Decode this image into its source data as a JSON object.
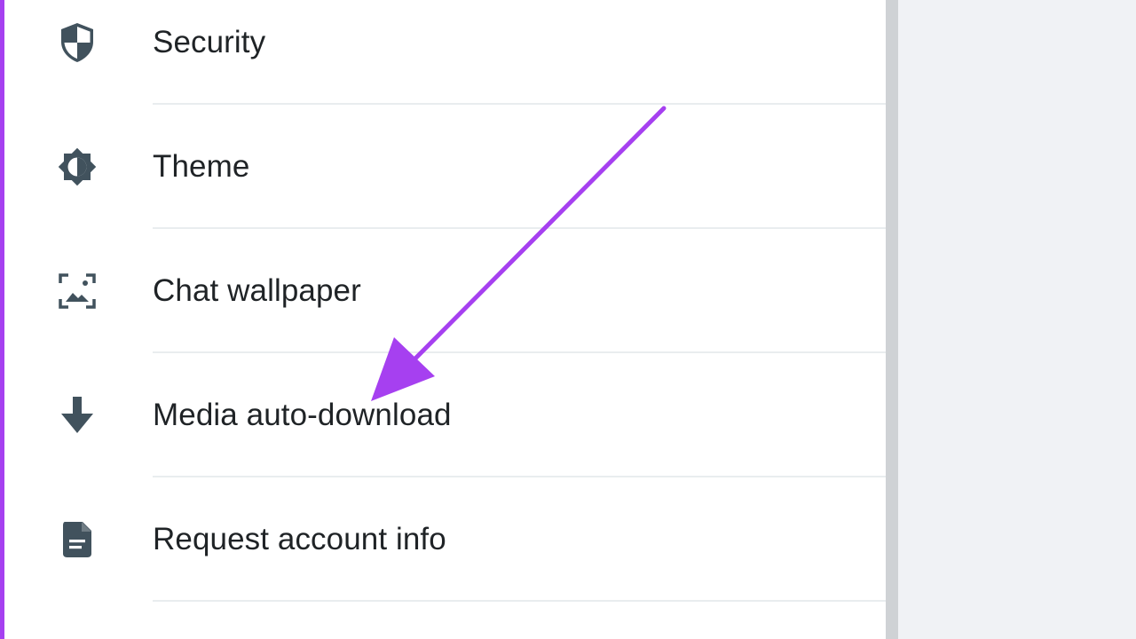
{
  "settings": {
    "items": [
      {
        "label": "Security",
        "icon": "shield-icon"
      },
      {
        "label": "Theme",
        "icon": "theme-icon"
      },
      {
        "label": "Chat wallpaper",
        "icon": "wallpaper-icon"
      },
      {
        "label": "Media auto-download",
        "icon": "download-icon"
      },
      {
        "label": "Request account info",
        "icon": "document-icon"
      }
    ]
  },
  "colors": {
    "accent": "#a640f0",
    "icon": "#41525d",
    "text": "#1f2326",
    "divider": "#e9edef",
    "right_pane": "#f0f2f5"
  }
}
